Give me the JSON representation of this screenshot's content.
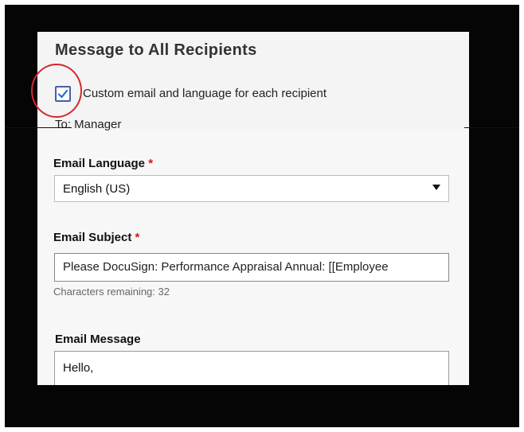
{
  "dialog": {
    "title": "Message to All Recipients",
    "custom_checkbox_label": "Custom email and language for each recipient",
    "custom_checkbox_checked": true,
    "to_label": "To: Manager"
  },
  "email_language": {
    "label": "Email Language",
    "required_mark": "*",
    "value": "English (US)"
  },
  "email_subject": {
    "label": "Email Subject",
    "required_mark": "*",
    "value": "Please DocuSign: Performance Appraisal Annual: [[Employee",
    "chars_remaining": "Characters remaining: 32"
  },
  "email_message": {
    "label": "Email Message",
    "value": "Hello,"
  },
  "colors": {
    "highlight_circle": "#d7262e",
    "checkbox_border": "#4a5ea8",
    "required": "#dd1111"
  }
}
